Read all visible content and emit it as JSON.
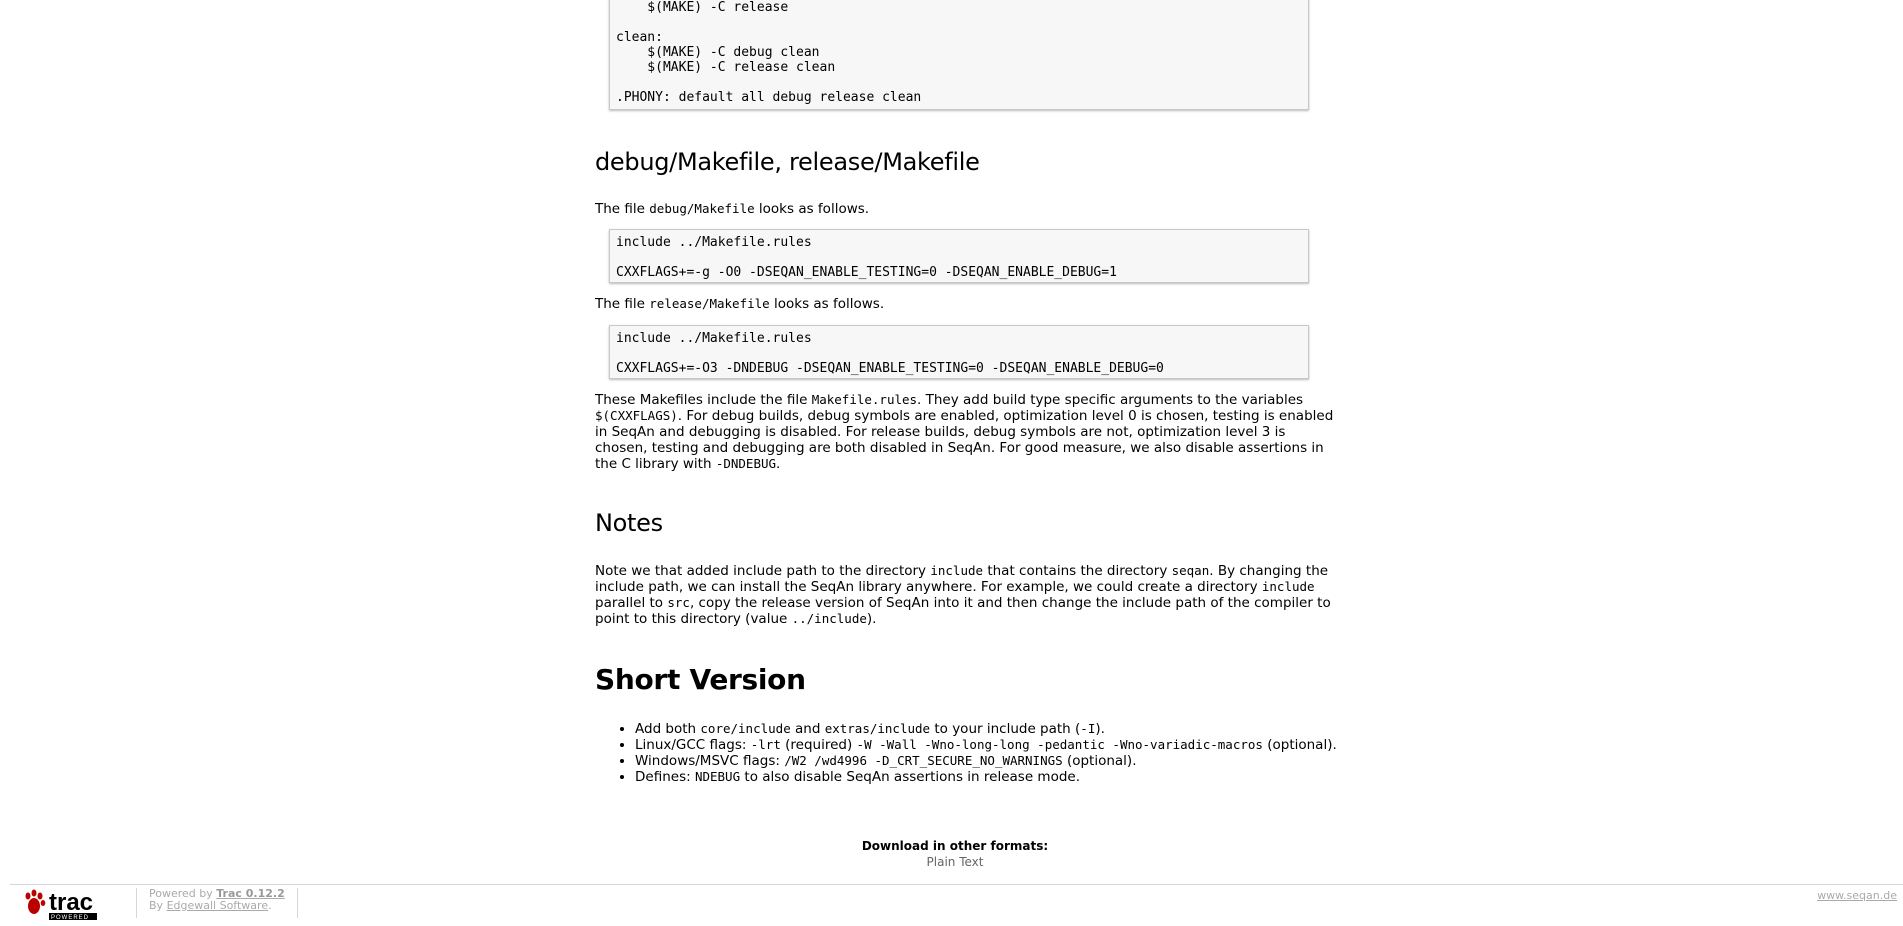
{
  "code_top": "    $(MAKE) -C release\n\nclean:\n    $(MAKE) -C debug clean\n    $(MAKE) -C release clean\n\n.PHONY: default all debug release clean",
  "section_makefiles": {
    "heading": "debug/Makefile, release/Makefile",
    "p1_pre": "The file ",
    "p1_code": "debug/Makefile",
    "p1_post": " looks as follows.",
    "code1": "include ../Makefile.rules\n\nCXXFLAGS+=-g -O0 -DSEQAN_ENABLE_TESTING=0 -DSEQAN_ENABLE_DEBUG=1",
    "p2_pre": "The file ",
    "p2_code": "release/Makefile",
    "p2_post": " looks as follows.",
    "code2": "include ../Makefile.rules\n\nCXXFLAGS+=-O3 -DNDEBUG -DSEQAN_ENABLE_TESTING=0 -DSEQAN_ENABLE_DEBUG=0",
    "p3_a": "These Makefiles include the file ",
    "p3_code1": "Makefile.rules",
    "p3_b": ". They add build type specific arguments to the variables ",
    "p3_code2": "$(CXXFLAGS)",
    "p3_c": ". For debug builds, debug symbols are enabled, optimization level 0 is chosen, testing is enabled in SeqAn and debugging is disabled. For release builds, debug symbols are not, optimization level 3 is chosen, testing and debugging are both disabled in SeqAn. For good measure, we also disable assertions in the C library with ",
    "p3_code3": "-DNDEBUG",
    "p3_d": "."
  },
  "section_notes": {
    "heading": "Notes",
    "a": "Note we that added include path to the directory ",
    "code1": "include",
    "b": " that contains the directory ",
    "code2": "seqan",
    "c": ". By changing the include path, we can install the SeqAn library anywhere. For example, we could create a directory ",
    "code3": "include",
    "d": " parallel to ",
    "code4": "src",
    "e": ", copy the release version of SeqAn into it and then change the include path of the compiler to point to this directory (value ",
    "code5": "../include",
    "f": ")."
  },
  "section_short": {
    "heading": "Short Version",
    "li1_a": "Add both ",
    "li1_code1": "core/include",
    "li1_b": " and ",
    "li1_code2": "extras/include",
    "li1_c": " to your include path (",
    "li1_code3": "-I",
    "li1_d": ").",
    "li2_a": "Linux/GCC flags: ",
    "li2_code1": "-lrt",
    "li2_b": " (required) ",
    "li2_code2": "-W -Wall -Wno-long-long -pedantic -Wno-variadic-macros",
    "li2_c": " (optional).",
    "li3_a": "Windows/MSVC flags: ",
    "li3_code1": "/W2 /wd4996 -D_CRT_SECURE_NO_WARNINGS",
    "li3_b": " (optional).",
    "li4_a": "Defines: ",
    "li4_code1": "NDEBUG",
    "li4_b": " to also disable SeqAn assertions in release mode."
  },
  "download": {
    "title": "Download in other formats:",
    "plain_text": "Plain Text"
  },
  "footer": {
    "logo_text": "trac",
    "logo_sub": "POWERED",
    "powered_by": "Powered by ",
    "trac_version": "Trac 0.12.2",
    "by": "By ",
    "edgewall": "Edgewall Software",
    "period": ".",
    "site": "www.seqan.de"
  }
}
